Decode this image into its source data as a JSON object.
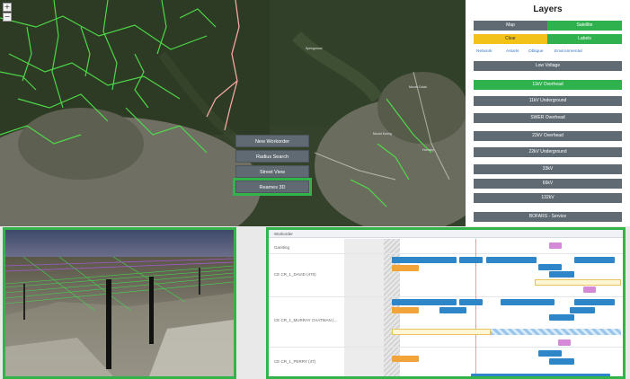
{
  "context_menu": {
    "items": [
      "New Workorder",
      "Radius Search",
      "Street View",
      "Reames 3D"
    ],
    "selected_index": 3
  },
  "layers": {
    "title": "Layers",
    "basemap": {
      "map": "Map",
      "satellite": "Satellite"
    },
    "overlay": {
      "clear": "Clear",
      "labels": "Labels"
    },
    "tabs": [
      "Network",
      "Assets",
      "Oblique",
      "Environmental"
    ],
    "items": [
      "Low Voltage",
      "11kV Overhead",
      "11kV Underground",
      "SWER Overhead",
      "22kV Overhead",
      "22kV Underground",
      "33kV",
      "66kV",
      "132kV",
      "BOFARS - Service"
    ],
    "active_index": 1,
    "colors": {
      "green": "#2fb24d",
      "yellow": "#f2c21a",
      "gray": "#5f6a72"
    }
  },
  "scheduler": {
    "header": "Workorder",
    "rows": [
      "Gantting",
      "CE CR_1_DAVID (470)",
      "CE CR_1_MURRAY CHATMAN (...",
      "CE CR_1_PERRY (47)"
    ]
  },
  "map_controls": {
    "zoom_in": "+",
    "zoom_out": "−"
  }
}
